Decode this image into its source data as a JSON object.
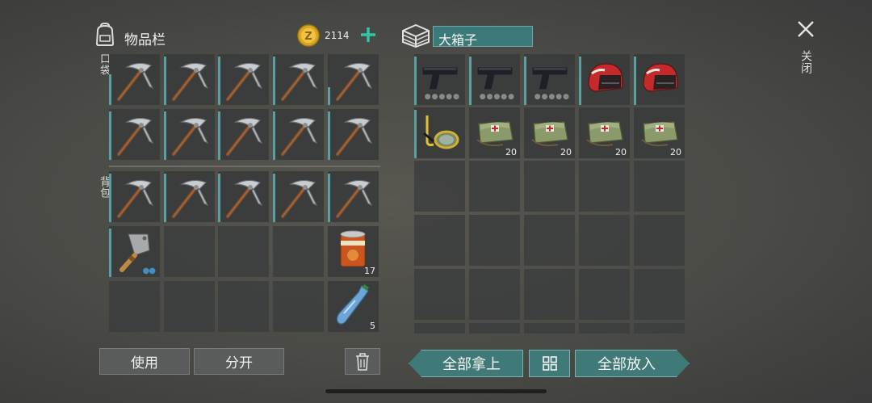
{
  "inventory": {
    "title": "物品栏",
    "coins": "2114",
    "pocket_label": "口袋",
    "backpack_label": "背包",
    "icons": [
      "backpack-icon",
      "coin-icon",
      "plus-icon"
    ]
  },
  "container": {
    "name": "大箱子",
    "icon": "box-icon"
  },
  "quantities": {
    "food_can": "17",
    "water_bottle": "5",
    "medkit_1": "20",
    "medkit_2": "20",
    "medkit_3": "20",
    "medkit_4": "20"
  },
  "buttons": {
    "use": "使用",
    "split": "分开",
    "take_all": "全部拿上",
    "put_all": "全部放入"
  },
  "close_label": "关闭",
  "colors": {
    "accent_teal": "#3f7a78",
    "plus_green": "#2fc7a7",
    "slot_bg": "#3a3c3c",
    "durability_tick": "#5aa0a0"
  }
}
